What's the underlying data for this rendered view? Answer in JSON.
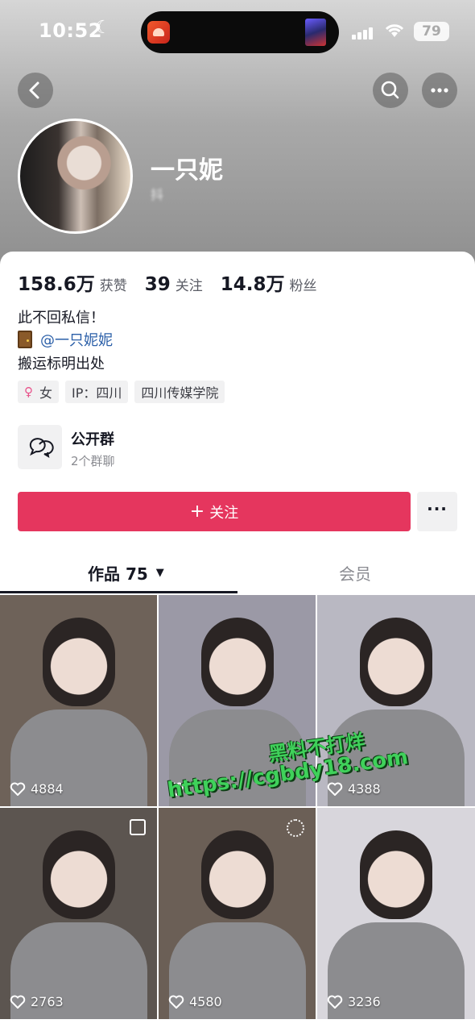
{
  "status_bar": {
    "time": "10:52",
    "battery": "79"
  },
  "profile": {
    "username": "一只妮",
    "user_id_blurred": "抖",
    "stats": [
      {
        "value": "158.6万",
        "label": "获赞"
      },
      {
        "value": "39",
        "label": "关注"
      },
      {
        "value": "14.8万",
        "label": "粉丝"
      }
    ],
    "bio": {
      "line1": "此不回私信！",
      "mention": "@一只妮妮",
      "line3": "搬运标明出处"
    },
    "tags": {
      "gender": "女",
      "ip": "IP：四川",
      "school": "四川传媒学院"
    },
    "group": {
      "title": "公开群",
      "subtitle": "2个群聊"
    },
    "follow_label": "关注",
    "more_label": "···"
  },
  "tabs": {
    "works": "作品 75",
    "members": "会员"
  },
  "videos": [
    {
      "likes": "4884",
      "bg": "#6e6259"
    },
    {
      "likes": "",
      "bg": "#9b99a6"
    },
    {
      "likes": "4388",
      "bg": "#b9b8c2"
    },
    {
      "likes": "2763",
      "bg": "#5c5550"
    },
    {
      "likes": "4580",
      "bg": "#6b5f56"
    },
    {
      "likes": "3236",
      "bg": "#d8d6dc"
    }
  ],
  "watermark": {
    "line1": "黑料不打烊",
    "line2": "https://cgbdy18.com"
  }
}
